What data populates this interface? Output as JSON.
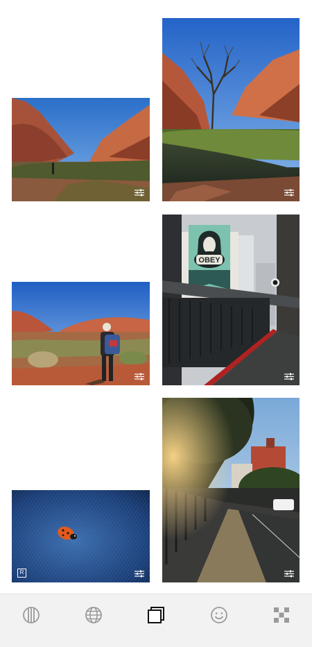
{
  "feed": {
    "photos": [
      {
        "id": "canyon-hiker",
        "edited": true
      },
      {
        "id": "creek-tree",
        "edited": true
      },
      {
        "id": "obey-mural",
        "edited": true
      },
      {
        "id": "desert-backpacker",
        "edited": true
      },
      {
        "id": "street-sunset",
        "edited": true
      },
      {
        "id": "ladybug-denim",
        "edited": true,
        "badge": "R"
      }
    ]
  },
  "tabbar": {
    "tabs": [
      {
        "icon": "collections-icon",
        "active": false
      },
      {
        "icon": "globe-icon",
        "active": false
      },
      {
        "icon": "stack-icon",
        "active": true
      },
      {
        "icon": "smiley-icon",
        "active": false
      },
      {
        "icon": "grid-icon",
        "active": false
      }
    ],
    "colors": {
      "active": "#111111",
      "inactive": "#9a9a9a"
    }
  }
}
